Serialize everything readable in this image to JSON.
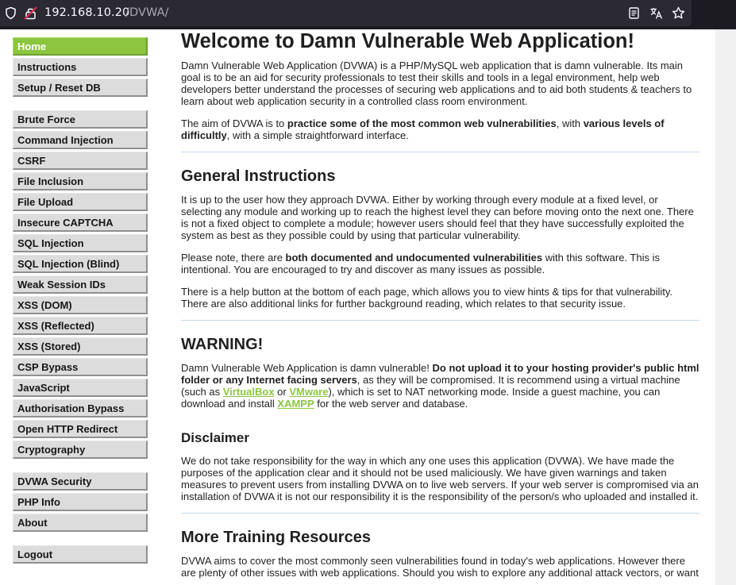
{
  "browser": {
    "url_host": "192.168.10.20",
    "url_path": "/DVWA/",
    "icons": [
      "shield-icon",
      "lock-icon",
      "reader-view-icon",
      "translate-icon",
      "bookmark-star-icon"
    ]
  },
  "colors": {
    "accent": "#8cc63f",
    "menu_bg": "#dcdcdc",
    "chrome_bg": "#2b2a33"
  },
  "menu": {
    "group1": [
      "Home",
      "Instructions",
      "Setup / Reset DB"
    ],
    "group2": [
      "Brute Force",
      "Command Injection",
      "CSRF",
      "File Inclusion",
      "File Upload",
      "Insecure CAPTCHA",
      "SQL Injection",
      "SQL Injection (Blind)",
      "Weak Session IDs",
      "XSS (DOM)",
      "XSS (Reflected)",
      "XSS (Stored)",
      "CSP Bypass",
      "JavaScript",
      "Authorisation Bypass",
      "Open HTTP Redirect",
      "Cryptography"
    ],
    "group3": [
      "DVWA Security",
      "PHP Info",
      "About"
    ],
    "group4": [
      "Logout"
    ],
    "selected": "Home"
  },
  "main": {
    "title": "Welcome to Damn Vulnerable Web Application!",
    "intro1": "Damn Vulnerable Web Application (DVWA) is a PHP/MySQL web application that is damn vulnerable. Its main goal is to be an aid for security professionals to test their skills and tools in a legal environment, help web developers better understand the processes of securing web applications and to aid both students & teachers to learn about web application security in a controlled class room environment.",
    "intro2_a": "The aim of DVWA is to ",
    "intro2_b": "practice some of the most common web vulnerabilities",
    "intro2_c": ", with ",
    "intro2_d": "various levels of difficultly",
    "intro2_e": ", with a simple straightforward interface.",
    "gi_heading": "General Instructions",
    "gi_p1": "It is up to the user how they approach DVWA. Either by working through every module at a fixed level, or selecting any module and working up to reach the highest level they can before moving onto the next one. There is not a fixed object to complete a module; however users should feel that they have successfully exploited the system as best as they possible could by using that particular vulnerability.",
    "gi_p2_a": "Please note, there are ",
    "gi_p2_b": "both documented and undocumented vulnerabilities",
    "gi_p2_c": " with this software. This is intentional. You are encouraged to try and discover as many issues as possible.",
    "gi_p3": "There is a help button at the bottom of each page, which allows you to view hints & tips for that vulnerability. There are also additional links for further background reading, which relates to that security issue.",
    "warn_heading": "WARNING!",
    "warn_a": "Damn Vulnerable Web Application is damn vulnerable! ",
    "warn_b": "Do not upload it to your hosting provider's public html folder or any Internet facing servers",
    "warn_c": ", as they will be compromised. It is recommend using a virtual machine (such as ",
    "warn_link1": "VirtualBox",
    "warn_d": " or ",
    "warn_link2": "VMware",
    "warn_e": "), which is set to NAT networking mode. Inside a guest machine, you can download and install ",
    "warn_link3": "XAMPP",
    "warn_f": " for the web server and database.",
    "disc_heading": "Disclaimer",
    "disc_p": "We do not take responsibility for the way in which any one uses this application (DVWA). We have made the purposes of the application clear and it should not be used maliciously. We have given warnings and taken measures to prevent users from installing DVWA on to live web servers. If your web server is compromised via an installation of DVWA it is not our responsibility it is the responsibility of the person/s who uploaded and installed it.",
    "mtr_heading": "More Training Resources",
    "mtr_p": "DVWA aims to cover the most commonly seen vulnerabilities found in today's web applications. However there are plenty of other issues with web applications. Should you wish to explore any additional attack vectors, or want"
  }
}
